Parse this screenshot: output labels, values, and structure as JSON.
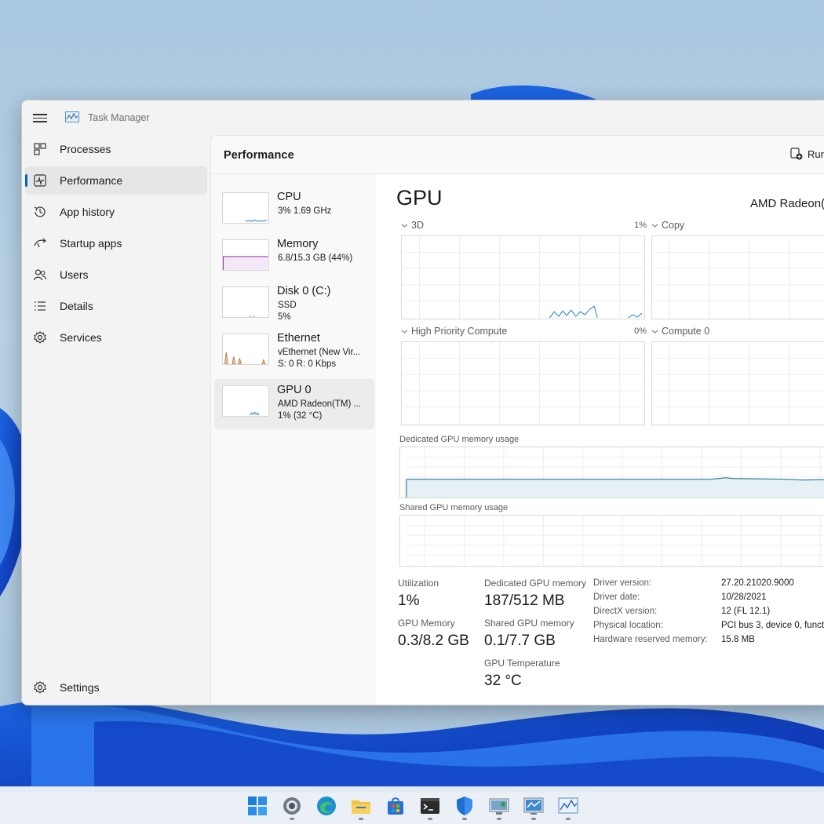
{
  "window": {
    "title": "Task Manager"
  },
  "nav": {
    "items": [
      {
        "label": "Processes"
      },
      {
        "label": "Performance"
      },
      {
        "label": "App history"
      },
      {
        "label": "Startup apps"
      },
      {
        "label": "Users"
      },
      {
        "label": "Details"
      },
      {
        "label": "Services"
      }
    ],
    "settings_label": "Settings",
    "active": "Performance"
  },
  "header": {
    "title": "Performance",
    "run_label": "Run"
  },
  "devices": [
    {
      "name": "CPU",
      "sub1": "3%  1.69 GHz",
      "sub2": ""
    },
    {
      "name": "Memory",
      "sub1": "6.8/15.3 GB (44%)",
      "sub2": ""
    },
    {
      "name": "Disk 0 (C:)",
      "sub1": "SSD",
      "sub2": "5%"
    },
    {
      "name": "Ethernet",
      "sub1": "vEthernet (New Vir...",
      "sub2": "S: 0  R: 0 Kbps"
    },
    {
      "name": "GPU 0",
      "sub1": "AMD Radeon(TM) ...",
      "sub2": "1%  (32 °C)"
    }
  ],
  "gpu": {
    "title": "GPU",
    "model": "AMD Radeon(",
    "engines": [
      {
        "label": "3D",
        "pct": "1%"
      },
      {
        "label": "Copy",
        "pct": ""
      },
      {
        "label": "High Priority Compute",
        "pct": "0%"
      },
      {
        "label": "Compute 0",
        "pct": ""
      }
    ],
    "dedicated_graph_label": "Dedicated GPU memory usage",
    "shared_graph_label": "Shared GPU memory usage",
    "stats": {
      "utilization_label": "Utilization",
      "utilization": "1%",
      "gpu_memory_label": "GPU Memory",
      "gpu_memory": "0.3/8.2 GB",
      "dedicated_label": "Dedicated GPU memory",
      "dedicated": "187/512 MB",
      "shared_label": "Shared GPU memory",
      "shared": "0.1/7.7 GB",
      "temp_label": "GPU Temperature",
      "temp": "32 °C"
    },
    "info": [
      {
        "label": "Driver version:",
        "value": "27.20.21020.9000"
      },
      {
        "label": "Driver date:",
        "value": "10/28/2021"
      },
      {
        "label": "DirectX version:",
        "value": "12 (FL 12.1)"
      },
      {
        "label": "Physical location:",
        "value": "PCI bus 3, device 0, funct"
      },
      {
        "label": "Hardware reserved memory:",
        "value": "15.8 MB"
      }
    ]
  },
  "colors": {
    "accent": "#0067c0",
    "gpu_line": "#1a7fd1",
    "memory_line": "#9b3fa8",
    "ethernet_line": "#b8651b",
    "dedicated_line": "#2f7a9a"
  },
  "taskbar": {
    "icons": [
      "start-icon",
      "settings-icon",
      "edge-icon",
      "file-explorer-icon",
      "store-icon",
      "terminal-icon",
      "security-icon",
      "remote-desktop-icon",
      "network-monitor-icon",
      "task-manager-icon"
    ]
  }
}
